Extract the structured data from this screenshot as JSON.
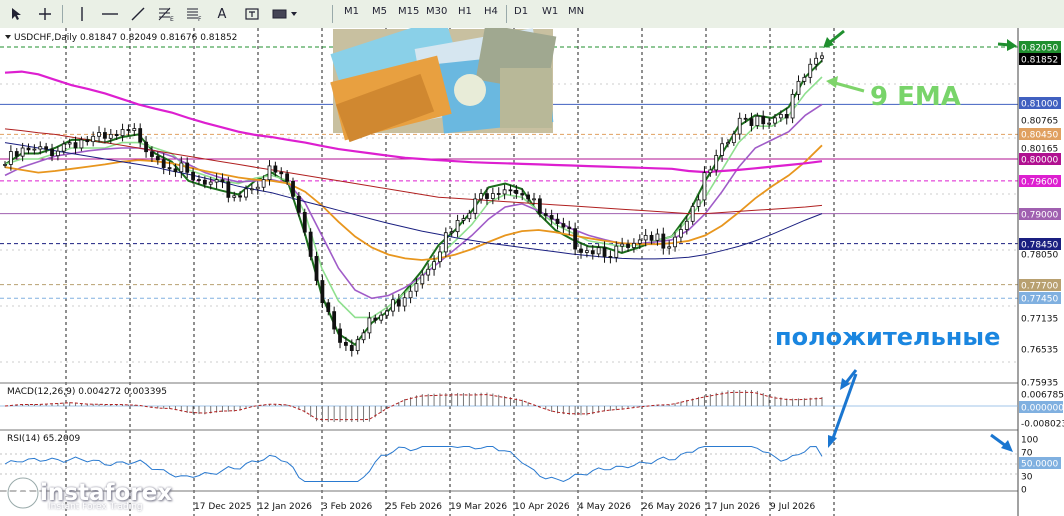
{
  "toolbar": {
    "tools": [
      "cursor",
      "crosshair",
      "vertical-line",
      "horizontal-line",
      "trend-line",
      "fibonacci",
      "fibo-tools",
      "text",
      "label",
      "shapes"
    ],
    "text_tool": "A",
    "timeframes": [
      "M1",
      "M5",
      "M15",
      "M30",
      "H1",
      "H4",
      "D1",
      "W1",
      "MN"
    ]
  },
  "chart_header": "USDCHF,Daily  0.81847 0.82049 0.81676 0.81852",
  "annotations": {
    "ema": "9 EMA",
    "positive": "положительные"
  },
  "watermark": {
    "name": "instaforex",
    "tagline": "Instant Forex Trading"
  },
  "colors": {
    "bg": "#ffffff",
    "grid": "#222222",
    "candle": "#111111",
    "ema9": "#1b6e1b",
    "ema_light": "#8fe08f",
    "ema_purple": "#a05cc8",
    "ema_orange": "#e8961e",
    "ema_magenta": "#dd1fd0",
    "ema_red": "#b02020",
    "ema_navy": "#1a1f80",
    "arrow_green": "#1f8f2e",
    "arrow_lightgreen": "#7ed46a",
    "arrow_blue": "#1a76d0",
    "text_green": "#78d46a",
    "text_blue": "#1a86e0"
  },
  "chart_data": [
    {
      "type": "candlestick",
      "symbol": "USDCHF",
      "timeframe": "Daily",
      "ohlc_last": {
        "open": 0.81847,
        "high": 0.82049,
        "low": 0.81676,
        "close": 0.81852
      },
      "price_axis": [
        "0.82050",
        "0.81852",
        "0.81000",
        "0.80765",
        "0.80450",
        "0.80165",
        "0.80000",
        "0.79600",
        "0.79000",
        "0.78450",
        "0.78050",
        "0.77700",
        "0.77450",
        "0.77135",
        "0.76535",
        "0.75935"
      ],
      "price_levels": [
        {
          "price": 0.8205,
          "label": "0.82050",
          "color": "#1f8f2e",
          "style": "dash"
        },
        {
          "price": 0.8185,
          "label": "0.81852",
          "color": "#000000",
          "style": "none"
        },
        {
          "price": 0.81,
          "label": "0.81000",
          "color": "#4060c0",
          "style": "solid"
        },
        {
          "price": 0.8045,
          "label": "0.80450",
          "color": "#e0a060",
          "style": "dash"
        },
        {
          "price": 0.8,
          "label": "0.80000",
          "color": "#b01090",
          "style": "solid"
        },
        {
          "price": 0.796,
          "label": "0.79600",
          "color": "#dd1fd0",
          "style": "dash"
        },
        {
          "price": 0.79,
          "label": "0.79000",
          "color": "#a060b0",
          "style": "solid"
        },
        {
          "price": 0.7845,
          "label": "0.78450",
          "color": "#1a1f80",
          "style": "dash"
        },
        {
          "price": 0.777,
          "label": "0.77700",
          "color": "#b8a070",
          "style": "dash"
        },
        {
          "price": 0.7745,
          "label": "0.77450",
          "color": "#80b0e0",
          "style": "dash"
        }
      ],
      "date_labels": [
        "17 Dec 2025",
        "12 Jan 2026",
        "3 Feb 2026",
        "25 Feb 2026",
        "19 Mar 2026",
        "10 Apr 2026",
        "4 May 2026",
        "26 May 2026",
        "17 Jun 2026",
        "9 Jul 2026"
      ],
      "series": [
        {
          "values": [
            0.799,
            0.801,
            0.801,
            0.802,
            0.8035,
            0.8035,
            0.803,
            0.804,
            0.8045,
            0.801,
            0.7995,
            0.796,
            0.795,
            0.7942,
            0.7935,
            0.796,
            0.7975,
            0.7955,
            0.7862,
            0.775,
            0.768,
            0.766,
            0.77,
            0.7722,
            0.7758,
            0.7795,
            0.7842,
            0.787,
            0.7905,
            0.7948,
            0.7955,
            0.7945,
            0.79,
            0.787,
            0.7853,
            0.784,
            0.7838,
            0.7828,
            0.7838,
            0.785,
            0.7858,
            0.79,
            0.796,
            0.801,
            0.806,
            0.808,
            0.8075,
            0.8095,
            0.815,
            0.818
          ]
        },
        {
          "values": [
            0.799,
            0.8,
            0.8,
            0.801,
            0.802,
            0.802,
            0.802,
            0.803,
            0.803,
            0.802,
            0.801,
            0.798,
            0.797,
            0.796,
            0.7955,
            0.7965,
            0.797,
            0.796,
            0.79,
            0.78,
            0.774,
            0.771,
            0.771,
            0.773,
            0.7755,
            0.7785,
            0.7822,
            0.785,
            0.788,
            0.792,
            0.7935,
            0.793,
            0.7905,
            0.788,
            0.7865,
            0.785,
            0.7845,
            0.784,
            0.7842,
            0.785,
            0.7858,
            0.789,
            0.793,
            0.798,
            0.803,
            0.806,
            0.806,
            0.808,
            0.812,
            0.815
          ]
        },
        {
          "values": [
            0.797,
            0.7985,
            0.7995,
            0.8005,
            0.801,
            0.8015,
            0.8018,
            0.802,
            0.802,
            0.8015,
            0.8005,
            0.799,
            0.7975,
            0.7965,
            0.7958,
            0.796,
            0.7962,
            0.7955,
            0.792,
            0.786,
            0.78,
            0.776,
            0.7745,
            0.775,
            0.7765,
            0.7785,
            0.781,
            0.7835,
            0.786,
            0.789,
            0.7912,
            0.7918,
            0.7905,
            0.7888,
            0.7872,
            0.786,
            0.7852,
            0.7845,
            0.7845,
            0.7848,
            0.7852,
            0.787,
            0.79,
            0.794,
            0.7985,
            0.802,
            0.8035,
            0.805,
            0.808,
            0.81
          ]
        },
        {
          "values": [
            0.7985,
            0.798,
            0.7975,
            0.7978,
            0.7982,
            0.7986,
            0.799,
            0.7995,
            0.7998,
            0.7996,
            0.7992,
            0.7985,
            0.7978,
            0.7972,
            0.7966,
            0.7962,
            0.796,
            0.7955,
            0.794,
            0.7915,
            0.7885,
            0.7858,
            0.7838,
            0.7825,
            0.7818,
            0.7815,
            0.7818,
            0.7825,
            0.7835,
            0.7848,
            0.786,
            0.7868,
            0.787,
            0.7866,
            0.786,
            0.7855,
            0.785,
            0.7846,
            0.7844,
            0.7844,
            0.7846,
            0.785,
            0.786,
            0.7878,
            0.7902,
            0.7928,
            0.795,
            0.797,
            0.7995,
            0.8025
          ]
        },
        {
          "values": [
            0.8158,
            0.816,
            0.8155,
            0.8145,
            0.8135,
            0.8128,
            0.812,
            0.811,
            0.81,
            0.8092,
            0.8085,
            0.8075,
            0.8066,
            0.8058,
            0.805,
            0.8044,
            0.804,
            0.8035,
            0.803,
            0.8024,
            0.8018,
            0.8014,
            0.801,
            0.8006,
            0.8002,
            0.8,
            0.7998,
            0.7996,
            0.7994,
            0.7993,
            0.7992,
            0.7991,
            0.799,
            0.7989,
            0.7988,
            0.7987,
            0.7986,
            0.7985,
            0.7984,
            0.7983,
            0.7982,
            0.7978,
            0.7976,
            0.7978,
            0.798,
            0.7983,
            0.7986,
            0.7989,
            0.7992,
            0.7996
          ]
        },
        {
          "values": [
            0.8055,
            0.8052,
            0.8048,
            0.8045,
            0.804,
            0.8035,
            0.803,
            0.8025,
            0.802,
            0.8015,
            0.801,
            0.8005,
            0.8,
            0.7995,
            0.799,
            0.7985,
            0.798,
            0.7975,
            0.797,
            0.7965,
            0.796,
            0.7955,
            0.795,
            0.7945,
            0.794,
            0.7935,
            0.793,
            0.7928,
            0.7926,
            0.7924,
            0.7922,
            0.792,
            0.7918,
            0.7916,
            0.7914,
            0.7912,
            0.791,
            0.7908,
            0.7906,
            0.7904,
            0.7902,
            0.79,
            0.79,
            0.7902,
            0.7904,
            0.7906,
            0.7908,
            0.791,
            0.7912,
            0.7915
          ]
        },
        {
          "values": [
            0.803,
            0.8025,
            0.802,
            0.8015,
            0.801,
            0.8005,
            0.8,
            0.7995,
            0.799,
            0.7985,
            0.7978,
            0.7972,
            0.7965,
            0.7958,
            0.795,
            0.7944,
            0.7938,
            0.793,
            0.7922,
            0.7914,
            0.7906,
            0.7898,
            0.789,
            0.7882,
            0.7875,
            0.7868,
            0.7862,
            0.7856,
            0.7851,
            0.7846,
            0.7842,
            0.7838,
            0.7834,
            0.783,
            0.7826,
            0.7823,
            0.782,
            0.7818,
            0.7817,
            0.7817,
            0.7818,
            0.782,
            0.7825,
            0.7832,
            0.784,
            0.785,
            0.7862,
            0.7875,
            0.7888,
            0.79
          ]
        }
      ]
    },
    {
      "type": "bar",
      "indicator_label": "MACD(12,26,9) 0.004272 0.003395",
      "axis_labels": [
        "0.006785",
        "0.000000",
        "-0.008023"
      ],
      "levels": [
        {
          "value": 0.0,
          "label": "0.000000"
        }
      ]
    },
    {
      "type": "line",
      "indicator_label": "RSI(14) 65.2009",
      "axis_labels": [
        "100",
        "70",
        "50.0000",
        "30",
        "0"
      ],
      "levels": [
        {
          "value": 70
        },
        {
          "value": 50,
          "label": "50.0000"
        },
        {
          "value": 30
        }
      ],
      "last_value": 65.2009
    }
  ]
}
